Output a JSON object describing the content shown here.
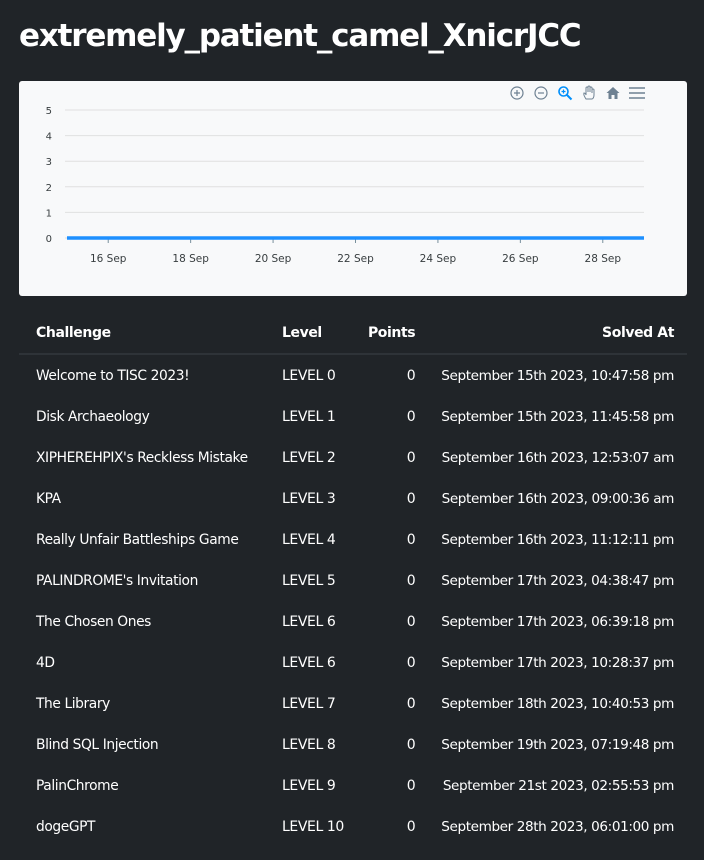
{
  "page": {
    "title": "extremely_patient_camel_XnicrJCC"
  },
  "chart_toolbar": [
    {
      "name": "zoom-in-icon"
    },
    {
      "name": "zoom-out-icon"
    },
    {
      "name": "selection-zoom-icon"
    },
    {
      "name": "pan-icon"
    },
    {
      "name": "reset-zoom-home-icon"
    },
    {
      "name": "menu-icon"
    }
  ],
  "colors": {
    "series": "#1e90ff",
    "background": "#202428",
    "card": "#f8f9fa"
  },
  "chart_data": {
    "type": "line",
    "title": "",
    "xlabel": "",
    "ylabel": "",
    "x": [
      "2023-09-15",
      "2023-09-15",
      "2023-09-16",
      "2023-09-16",
      "2023-09-16",
      "2023-09-17",
      "2023-09-17",
      "2023-09-17",
      "2023-09-18",
      "2023-09-19",
      "2023-09-21",
      "2023-09-28"
    ],
    "series": [
      {
        "values": [
          0,
          0,
          0,
          0,
          0,
          0,
          0,
          0,
          0,
          0,
          0,
          0
        ]
      }
    ],
    "xlim": [
      "2023-09-15",
      "2023-09-29"
    ],
    "ylim": [
      0,
      5
    ],
    "x_ticks": [
      "16 Sep",
      "18 Sep",
      "20 Sep",
      "22 Sep",
      "24 Sep",
      "26 Sep",
      "28 Sep"
    ],
    "y_ticks": [
      "0",
      "1",
      "2",
      "3",
      "4",
      "5"
    ],
    "grid": true
  },
  "table": {
    "headers": {
      "challenge": "Challenge",
      "level": "Level",
      "points": "Points",
      "solved_at": "Solved At"
    },
    "rows": [
      {
        "challenge": "Welcome to TISC 2023!",
        "level": "LEVEL 0",
        "points": "0",
        "solved_at": "September 15th 2023, 10:47:58 pm"
      },
      {
        "challenge": "Disk Archaeology",
        "level": "LEVEL 1",
        "points": "0",
        "solved_at": "September 15th 2023, 11:45:58 pm"
      },
      {
        "challenge": "XIPHEREHPIX's Reckless Mistake",
        "level": "LEVEL 2",
        "points": "0",
        "solved_at": "September 16th 2023, 12:53:07 am"
      },
      {
        "challenge": "KPA",
        "level": "LEVEL 3",
        "points": "0",
        "solved_at": "September 16th 2023, 09:00:36 am"
      },
      {
        "challenge": "Really Unfair Battleships Game",
        "level": "LEVEL 4",
        "points": "0",
        "solved_at": "September 16th 2023, 11:12:11 pm"
      },
      {
        "challenge": "PALINDROME's Invitation",
        "level": "LEVEL 5",
        "points": "0",
        "solved_at": "September 17th 2023, 04:38:47 pm"
      },
      {
        "challenge": "The Chosen Ones",
        "level": "LEVEL 6",
        "points": "0",
        "solved_at": "September 17th 2023, 06:39:18 pm"
      },
      {
        "challenge": "4D",
        "level": "LEVEL 6",
        "points": "0",
        "solved_at": "September 17th 2023, 10:28:37 pm"
      },
      {
        "challenge": "The Library",
        "level": "LEVEL 7",
        "points": "0",
        "solved_at": "September 18th 2023, 10:40:53 pm"
      },
      {
        "challenge": "Blind SQL Injection",
        "level": "LEVEL 8",
        "points": "0",
        "solved_at": "September 19th 2023, 07:19:48 pm"
      },
      {
        "challenge": "PalinChrome",
        "level": "LEVEL 9",
        "points": "0",
        "solved_at": "September 21st 2023, 02:55:53 pm"
      },
      {
        "challenge": "dogeGPT",
        "level": "LEVEL 10",
        "points": "0",
        "solved_at": "September 28th 2023, 06:01:00 pm"
      }
    ]
  }
}
